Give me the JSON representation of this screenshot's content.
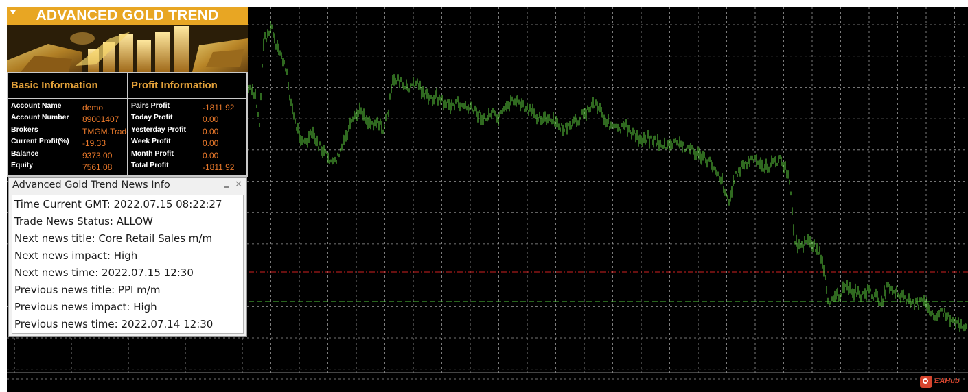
{
  "ea_panel": {
    "title": "ADVANCED GOLD TREND",
    "basic_info": {
      "header": "Basic Information",
      "rows": [
        {
          "label": "Account Name",
          "value": "demo"
        },
        {
          "label": "Account Number",
          "value": "89001407"
        },
        {
          "label": "Brokers",
          "value": "TMGM.TradeMa"
        },
        {
          "label": "Current Profit(%)",
          "value": "-19.33"
        },
        {
          "label": "Balance",
          "value": "9373.00"
        },
        {
          "label": "Equity",
          "value": "7561.08"
        }
      ]
    },
    "profit_info": {
      "header": "Profit Information",
      "rows": [
        {
          "label": "Pairs Profit",
          "value": "-1811.92"
        },
        {
          "label": "Today Profit",
          "value": "0.00"
        },
        {
          "label": "Yesterday Profit",
          "value": "0.00"
        },
        {
          "label": "Week Profit",
          "value": "0.00"
        },
        {
          "label": "Month Profit",
          "value": "0.00"
        },
        {
          "label": "Total Profit",
          "value": "-1811.92"
        }
      ]
    }
  },
  "news_window": {
    "title": "Advanced Gold Trend News Info",
    "lines": [
      "Time Current GMT: 2022.07.15 08:22:27",
      "Trade News Status: ALLOW",
      "Next news title: Core Retail Sales m/m",
      "Next news impact: High",
      "Next news time: 2022.07.15 12:30",
      "Previous news title: PPI m/m",
      "Previous news impact: High",
      "Previous news time: 2022.07.14 12:30"
    ]
  },
  "chart": {
    "background": "#000000",
    "bar_color": "#5fd33f",
    "grid_color": "#9a9a9a",
    "level_lines": [
      {
        "kind": "red-dashed",
        "color": "#d11f1f"
      },
      {
        "kind": "green-dashed",
        "color": "#4fc63a"
      }
    ]
  },
  "colors": {
    "accent_gold": "#e8a623",
    "section_header": "#e3a13a",
    "value_orange": "#e8782a"
  },
  "watermark": {
    "text": "EAHub"
  },
  "icons": {
    "collapse": "triangle-down-icon",
    "minimize": "minimize-icon",
    "close": "close-icon",
    "watermark": "eahub-logo-icon"
  }
}
